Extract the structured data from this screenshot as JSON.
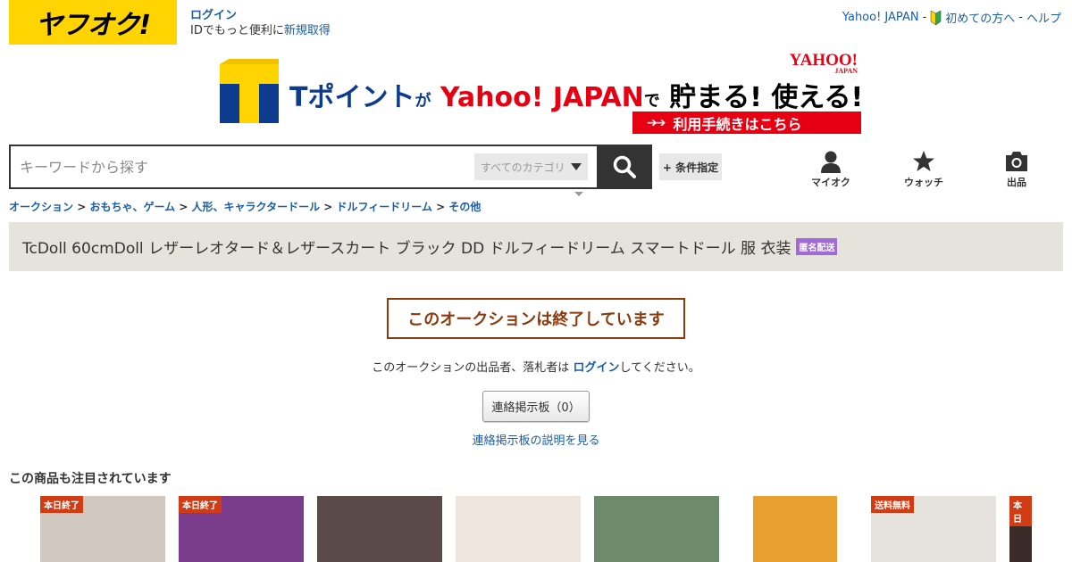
{
  "header": {
    "logo_text": "ヤフオク!",
    "login_label": "ログイン",
    "id_prompt": "IDでもっと便利に",
    "signup_label": "新規取得",
    "links": {
      "yahoo_japan": "Yahoo! JAPAN",
      "sep1": "-",
      "beginners": "初めての方へ",
      "sep2": "-",
      "help": "ヘルプ"
    }
  },
  "banner": {
    "tpoint": "Tポイント",
    "ga": "が",
    "yahoo": "Yahoo! JAPAN",
    "de": "で",
    "tagline": "貯まる! 使える!",
    "corner_logo": "YAHOO!",
    "corner_logo_sub": "JAPAN",
    "cta": "利用手続きはこちら",
    "cta_arrows": "➔➔"
  },
  "search": {
    "placeholder": "キーワードから探す",
    "category": "すべてのカテゴリ",
    "conditions_label": "+ 条件指定"
  },
  "nav": {
    "myauction": "マイオク",
    "watch": "ウォッチ",
    "sell": "出品"
  },
  "breadcrumb": [
    {
      "label": "オークション"
    },
    {
      "label": "おもちゃ、ゲーム"
    },
    {
      "label": "人形、キャラクタードール"
    },
    {
      "label": "ドルフィードリーム"
    },
    {
      "label": "その他"
    }
  ],
  "breadcrumb_sep": ">",
  "item": {
    "title": "TcDoll 60cmDoll レザーレオタード＆レザースカート ブラック DD ドルフィードリーム スマートドール 服 衣装",
    "badge": "匿名配送"
  },
  "ended": {
    "message": "このオークションは終了しています",
    "notice_before": "このオークションの出品者、落札者は",
    "notice_link": "ログイン",
    "notice_after": "してください。",
    "board_button": "連絡掲示板（0）",
    "board_help": "連絡掲示板の説明を見る"
  },
  "recommendations": {
    "title": "この商品も注目されています",
    "items": [
      {
        "badge": "本日終了",
        "bg": "#cfc7c0"
      },
      {
        "badge": "本日終了",
        "bg": "#7a3c8a"
      },
      {
        "badge": "",
        "bg": "#5a4a48"
      },
      {
        "badge": "",
        "bg": "#f0e6e0"
      },
      {
        "badge": "",
        "bg": "#6d8a6a"
      },
      {
        "badge": "",
        "bg": "#e8a030"
      },
      {
        "badge": "送料無料",
        "bg": "#e6e2de"
      },
      {
        "badge": "本日",
        "bg": "#3a2a28"
      }
    ]
  },
  "colors": {
    "brand_yellow": "#ffd400",
    "link_blue": "#1a5ea6",
    "ended_brown": "#8b3b0e",
    "badge_purple": "#a06ad8",
    "badge_red": "#d23c14"
  }
}
